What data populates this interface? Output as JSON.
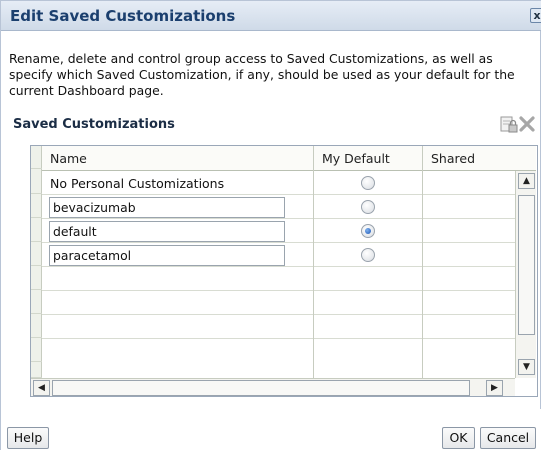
{
  "dialog": {
    "title": "Edit Saved Customizations",
    "close_glyph": "x",
    "description": "Rename, delete and control group access to Saved Customizations, as well as specify which Saved Customization, if any, should be used as your default for the current Dashboard page.",
    "section_title": "Saved Customizations"
  },
  "toolbar": {
    "icons": [
      "lock-edit-icon",
      "delete-x-icon"
    ]
  },
  "grid": {
    "columns": [
      "Name",
      "My Default",
      "Shared"
    ],
    "rows": [
      {
        "name": "No Personal Customizations",
        "editable": false,
        "is_default": false
      },
      {
        "name": "bevacizumab",
        "editable": true,
        "is_default": false
      },
      {
        "name": "default",
        "editable": true,
        "is_default": true
      },
      {
        "name": "paracetamol",
        "editable": true,
        "is_default": false
      }
    ]
  },
  "buttons": {
    "help": "Help",
    "ok": "OK",
    "cancel": "Cancel"
  },
  "colors": {
    "title_text": "#1b3f6e",
    "radio_selected": "#1e56b5"
  }
}
